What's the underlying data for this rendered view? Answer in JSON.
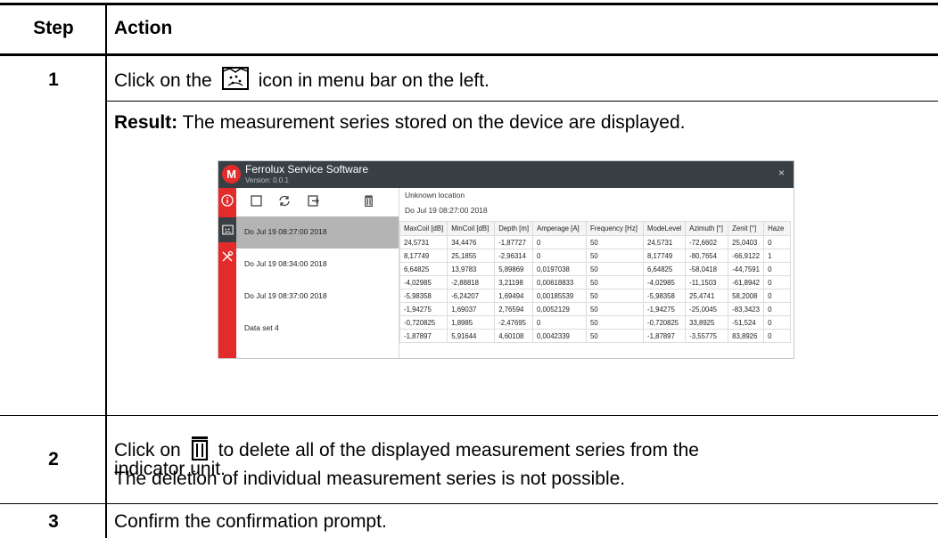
{
  "header": {
    "step": "Step",
    "action": "Action"
  },
  "steps": [
    {
      "number": "1",
      "instruction_before": "Click on the",
      "instruction_after": "icon in menu bar on the left.",
      "result_label": "Result:",
      "result_text": "The measurement series stored on the device are displayed."
    },
    {
      "number": "2",
      "instruction_before": "Click on",
      "instruction_after": "to delete all of the displayed measurement series from the",
      "instruction_line2": "indicator unit.",
      "note": "The deletion of individual measurement series is not possible."
    },
    {
      "number": "3",
      "instruction": "Confirm the confirmation prompt."
    }
  ],
  "app": {
    "logo": "M",
    "title": "Ferrolux Service Software",
    "version": "Version: 0.0.1",
    "close": "×",
    "location": "Unknown location",
    "timestamp": "Do Jul 19 08:27:00 2018",
    "datasets": [
      "Do Jul 19 08:27:00 2018",
      "Do Jul 19 08:34:00 2018",
      "Do Jul 19 08:37:00 2018",
      "Data set 4"
    ],
    "columns": [
      "MaxCoil [dB]",
      "MinCoil [dB]",
      "Depth [m]",
      "Amperage [A]",
      "Frequency [Hz]",
      "ModeLevel",
      "Azimuth [°]",
      "Zenit [°]",
      "Haze"
    ],
    "rows": [
      [
        "24,5731",
        "34,4476",
        "-1,87727",
        "0",
        "50",
        "24,5731",
        "-72,6602",
        "25,0403",
        "0"
      ],
      [
        "8,17749",
        "25,1855",
        "-2,96314",
        "0",
        "50",
        "8,17749",
        "-80,7654",
        "-66,9122",
        "1"
      ],
      [
        "6,64825",
        "13,9783",
        "5,89869",
        "0,0197038",
        "50",
        "6,64825",
        "-58,0418",
        "-44,7591",
        "0"
      ],
      [
        "-4,02985",
        "-2,88818",
        "3,21198",
        "0,00618833",
        "50",
        "-4,02985",
        "-11,1503",
        "-61,8942",
        "0"
      ],
      [
        "-5,98358",
        "-6,24207",
        "1,69494",
        "0,00185539",
        "50",
        "-5,98358",
        "25,4741",
        "58,2008",
        "0"
      ],
      [
        "-1,94275",
        "1,69037",
        "2,76594",
        "0,0052129",
        "50",
        "-1,94275",
        "-25,0045",
        "-83,3423",
        "0"
      ],
      [
        "-0,720825",
        "1,8985",
        "-2,47695",
        "0",
        "50",
        "-0,720825",
        "33,8925",
        "-51,524",
        "0"
      ],
      [
        "-1,87897",
        "5,91644",
        "4,60108",
        "0,0042339",
        "50",
        "-1,87897",
        "-3,55775",
        "83,8926",
        "0"
      ]
    ]
  },
  "icons": {
    "map": "map-icon",
    "delete": "trash-icon",
    "info": "info-icon",
    "tools": "tools-icon",
    "checkbox": "checkbox-icon",
    "refresh": "refresh-icon",
    "export": "export-icon"
  },
  "colors": {
    "app_titlebar": "#383f45",
    "app_nav": "#e32b2b",
    "selected_row": "#b4b4b4"
  }
}
